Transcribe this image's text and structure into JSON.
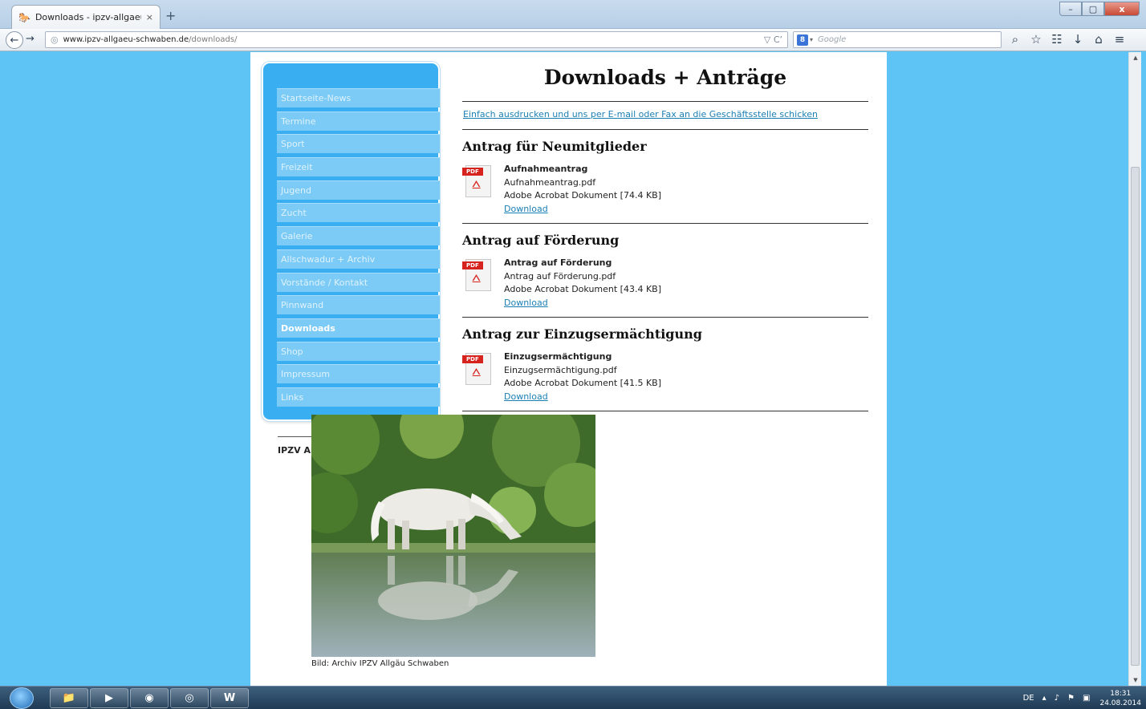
{
  "browser": {
    "tab_title": "Downloads - ipzv-allgaeu-...",
    "tab_close": "×",
    "new_tab": "+",
    "url_host": "www.ipzv-allgaeu-schwaben.de",
    "url_path": "/downloads/",
    "search_placeholder": "Google",
    "win_min": "–",
    "win_max": "▢",
    "win_close": "x"
  },
  "sidebar": {
    "items": [
      {
        "label": "Startseite-News"
      },
      {
        "label": "Termine"
      },
      {
        "label": "Sport"
      },
      {
        "label": "Freizeit"
      },
      {
        "label": "Jugend"
      },
      {
        "label": "Zucht"
      },
      {
        "label": "Galerie"
      },
      {
        "label": "Allschwadur + Archiv"
      },
      {
        "label": "Vorstände / Kontakt"
      },
      {
        "label": "Pinnwand"
      },
      {
        "label": "Downloads"
      },
      {
        "label": "Shop"
      },
      {
        "label": "Impressum"
      },
      {
        "label": "Links"
      }
    ],
    "active_index": 10,
    "club_name": "IPZV Allgäu Schwaben e.V."
  },
  "main": {
    "title": "Downloads + Anträge",
    "intro_link": "Einfach ausdrucken und uns per E-mail oder Fax an die Geschäftsstelle schicken",
    "sections": [
      {
        "heading": "Antrag für Neumitglieder",
        "name": "Aufnahmeantrag",
        "file": "Aufnahmeantrag.pdf",
        "type": "Adobe Acrobat Dokument [74.4 KB]",
        "link": "Download"
      },
      {
        "heading": "Antrag auf Förderung",
        "name": "Antrag auf Förderung",
        "file": "Antrag auf Förderung.pdf",
        "type": "Adobe Acrobat Dokument [43.4 KB]",
        "link": "Download"
      },
      {
        "heading": "Antrag zur Einzugsermächtigung",
        "name": "Einzugsermächtigung",
        "file": "Einzugsermächtigung.pdf",
        "type": "Adobe Acrobat Dokument [41.5 KB]",
        "link": "Download"
      }
    ],
    "pdf_badge": "PDF",
    "caption": "Bild: Archiv IPZV Allgäu Schwaben"
  },
  "taskbar": {
    "lang": "DE",
    "time": "18:31",
    "date": "24.08.2014"
  },
  "colors": {
    "page_bg": "#5ec3f5",
    "sidebar_bg": "#39aef0",
    "nav_item": "#7ccaf6",
    "link": "#1b7fb4"
  }
}
